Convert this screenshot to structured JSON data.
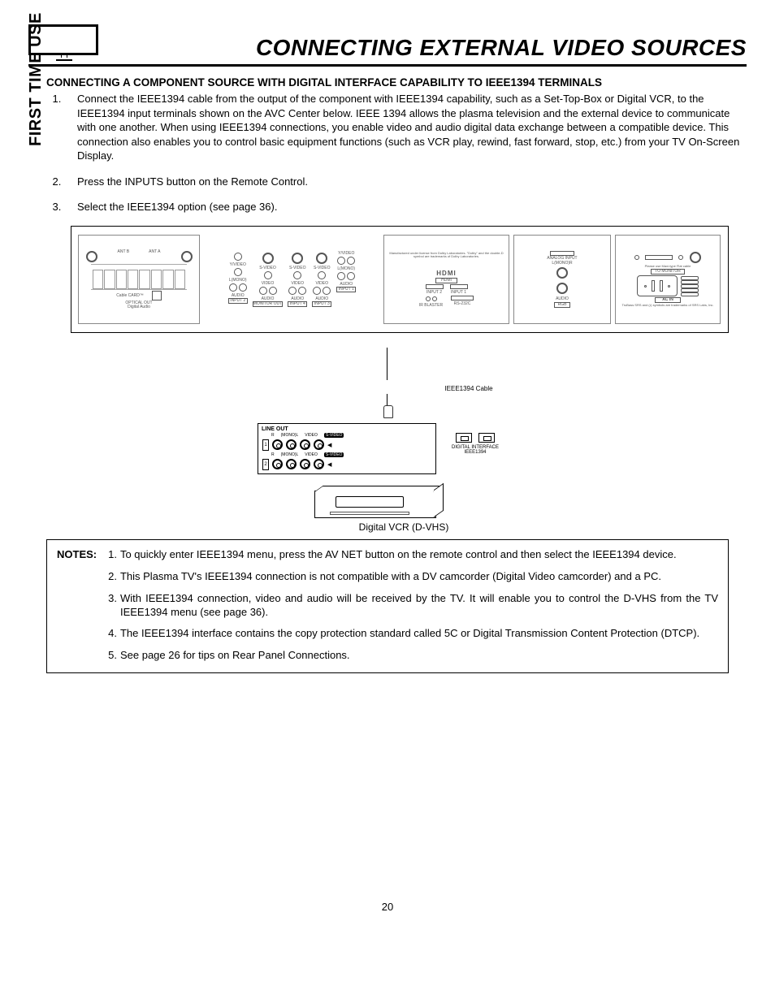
{
  "sideTab": "FIRST TIME USE",
  "pageTitle": "CONNECTING EXTERNAL VIDEO SOURCES",
  "sectionTitle": "CONNECTING A COMPONENT SOURCE WITH DIGITAL INTERFACE CAPABILITY TO IEEE1394 TERMINALS",
  "steps": [
    "Connect the IEEE1394 cable from the output of the component with IEEE1394 capability, such as a Set-Top-Box or Digital VCR, to the IEEE1394 input terminals shown on the AVC Center below.  IEEE 1394 allows the plasma television and the external device to communicate with one another.  When using IEEE1394 connections, you enable video and audio digital data exchange between a compatible device.  This connection also enables you to control basic equipment functions (such as VCR play, rewind, fast  forward, stop, etc.) from your TV On-Screen Display.",
    "Press the INPUTS button on the Remote Control.",
    "Select the IEEE1394 option (see page 36)."
  ],
  "diagram": {
    "antB": "ANT B",
    "antA": "ANT A",
    "cableCard": "Cable CARD™",
    "opticalOut": "OPTICAL OUT",
    "digitalAudio": "Digital Audio",
    "svideo": "S-VIDEO",
    "yvideo": "Y/VIDEO",
    "video": "VIDEO",
    "lmono": "L(MONO)",
    "audio": "AUDIO",
    "input1": "INPUT 1",
    "input2": "INPUT 2",
    "input3": "INPUT 3",
    "input4": "INPUT 4",
    "monitorOut": "MONITOR OUT",
    "hdmi": "HDMI",
    "hdmiInput1": "INPUT 1",
    "hdmiInput2": "INPUT 2",
    "irBlaster": "IR BLASTER",
    "rs232": "RS-232C",
    "analogInput": "ANALOG INPUT",
    "rgb": "RGB",
    "lmonor": "L(MONO)R",
    "toMonitor": "TO MONITOR",
    "acIn": "AC IN",
    "dolbyNote": "Manufactured under license from Dolby Laboratories. \"Dolby\" and the double-D symbol are trademarks of Dolby Laboratories.",
    "specNote": "Please use Maxi-type Flat cable",
    "srsNote": "TruBass SRS and (•) symbols are trademarks of SRS Labs, Inc."
  },
  "cable": {
    "label": "IEEE1394 Cable"
  },
  "lineout": {
    "title": "LINE OUT",
    "hdr": {
      "r": "R",
      "mono": "(MONO)L",
      "video": "VIDEO",
      "svideo": "S-VIDEO"
    },
    "rows": [
      "1",
      "2"
    ],
    "digitalInterface": "DIGITAL INTERFACE",
    "ieee": "IEEE1394"
  },
  "vcrCaption": "Digital VCR (D-VHS)",
  "notesLabel": "NOTES:",
  "notes": [
    {
      "n": "1.",
      "t": "To quickly enter IEEE1394 menu, press the AV NET button on the remote control and then select the IEEE1394 device."
    },
    {
      "n": "2.",
      "t": "This Plasma TV's IEEE1394 connection is not compatible with a DV camcorder (Digital Video camcorder) and a PC."
    },
    {
      "n": "3.",
      "t": "With IEEE1394 connection, video and audio will be received by the TV.  It will enable you to control the D-VHS from the TV IEEE1394 menu (see page 36)."
    },
    {
      "n": "4.",
      "t": "The IEEE1394 interface contains the copy protection standard called 5C or Digital Transmission Content Protection (DTCP)."
    },
    {
      "n": "5.",
      "t": "See page 26 for tips on Rear Panel Connections."
    }
  ],
  "pageNumber": "20"
}
